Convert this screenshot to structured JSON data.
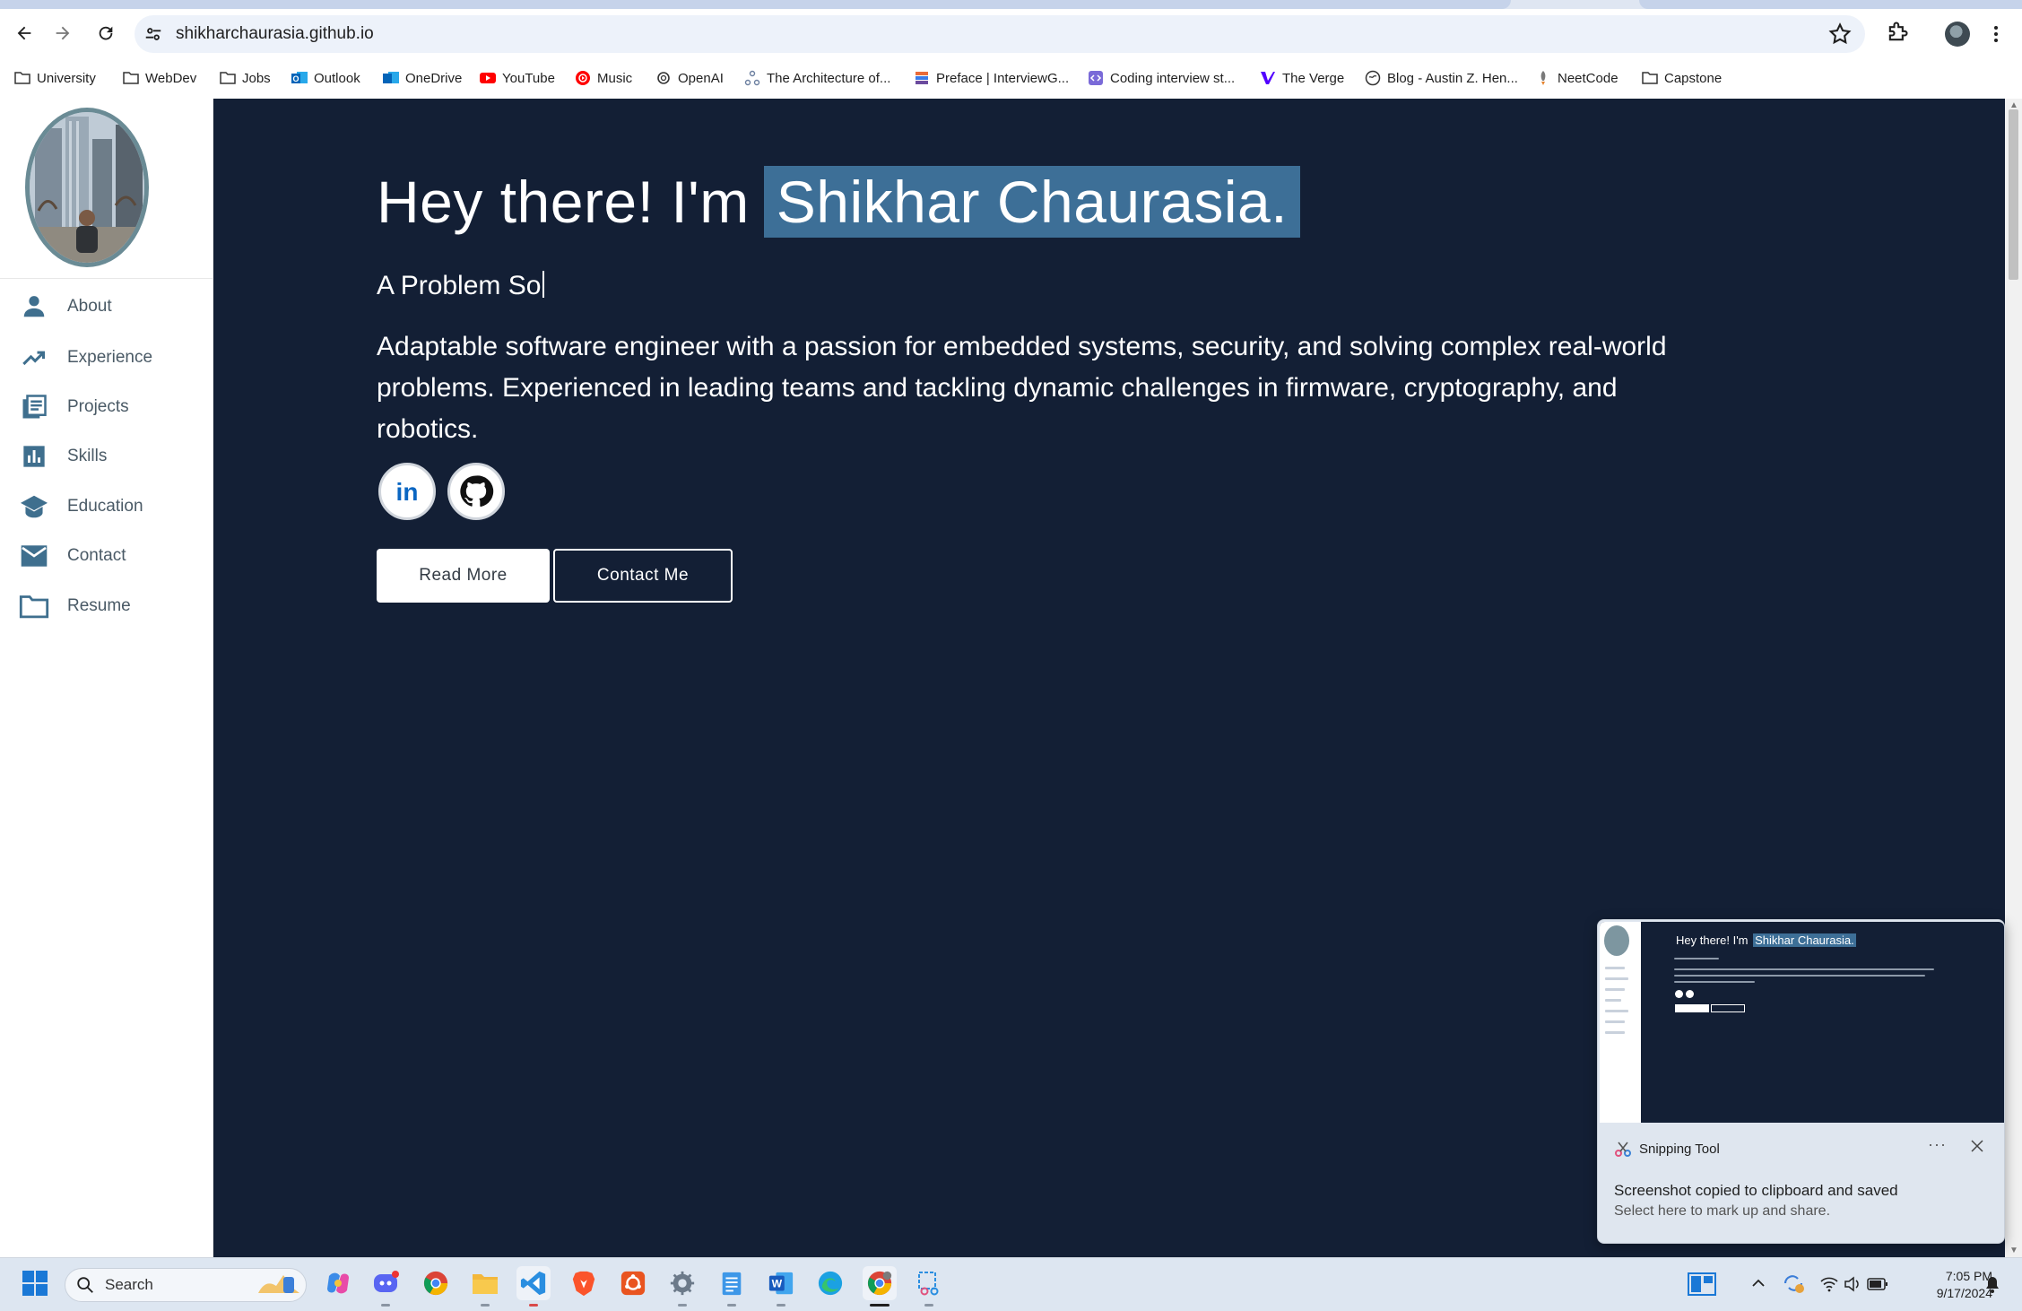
{
  "browser": {
    "url": "shikharchaurasia.github.io",
    "bookmarks": [
      {
        "label": "University",
        "icon": "folder-icon"
      },
      {
        "label": "WebDev",
        "icon": "folder-icon"
      },
      {
        "label": "Jobs",
        "icon": "folder-icon"
      },
      {
        "label": "Outlook",
        "icon": "outlook-icon"
      },
      {
        "label": "OneDrive",
        "icon": "onedrive-icon"
      },
      {
        "label": "YouTube",
        "icon": "youtube-icon"
      },
      {
        "label": "Music",
        "icon": "music-icon"
      },
      {
        "label": "OpenAI",
        "icon": "openai-icon"
      },
      {
        "label": "The Architecture of...",
        "icon": "architecture-icon"
      },
      {
        "label": "Preface | InterviewG...",
        "icon": "book-icon"
      },
      {
        "label": "Coding interview st...",
        "icon": "code-icon"
      },
      {
        "label": "The Verge",
        "icon": "verge-icon"
      },
      {
        "label": "Blog - Austin Z. Hen...",
        "icon": "globe-icon"
      },
      {
        "label": "NeetCode",
        "icon": "rocket-icon"
      },
      {
        "label": "Capstone",
        "icon": "folder-icon"
      }
    ]
  },
  "sidebar": {
    "items": [
      {
        "label": "About",
        "icon": "person-icon"
      },
      {
        "label": "Experience",
        "icon": "trending-up-icon"
      },
      {
        "label": "Projects",
        "icon": "document-stack-icon"
      },
      {
        "label": "Skills",
        "icon": "bar-chart-icon"
      },
      {
        "label": "Education",
        "icon": "graduation-cap-icon"
      },
      {
        "label": "Contact",
        "icon": "envelope-icon"
      },
      {
        "label": "Resume",
        "icon": "folder-outline-icon"
      }
    ]
  },
  "hero": {
    "greeting": "Hey there! I'm",
    "name": "Shikhar Chaurasia.",
    "typed_text": "A Problem So",
    "bio": "Adaptable software engineer with a passion for embedded systems, security, and solving complex real-world problems. Experienced in leading teams and tackling dynamic challenges in firmware, cryptography, and robotics.",
    "read_more": "Read More",
    "contact_me": "Contact Me"
  },
  "toast": {
    "app_name": "Snipping Tool",
    "title": "Screenshot copied to clipboard and saved",
    "subtitle": "Select here to mark up and share.",
    "more": "···"
  },
  "taskbar": {
    "search_label": "Search",
    "time": "7:05 PM",
    "date": "9/17/2024"
  },
  "colors": {
    "main_bg": "#131f35",
    "name_highlight": "#3d6f97",
    "sidebar_icon": "#3f6f8e"
  }
}
